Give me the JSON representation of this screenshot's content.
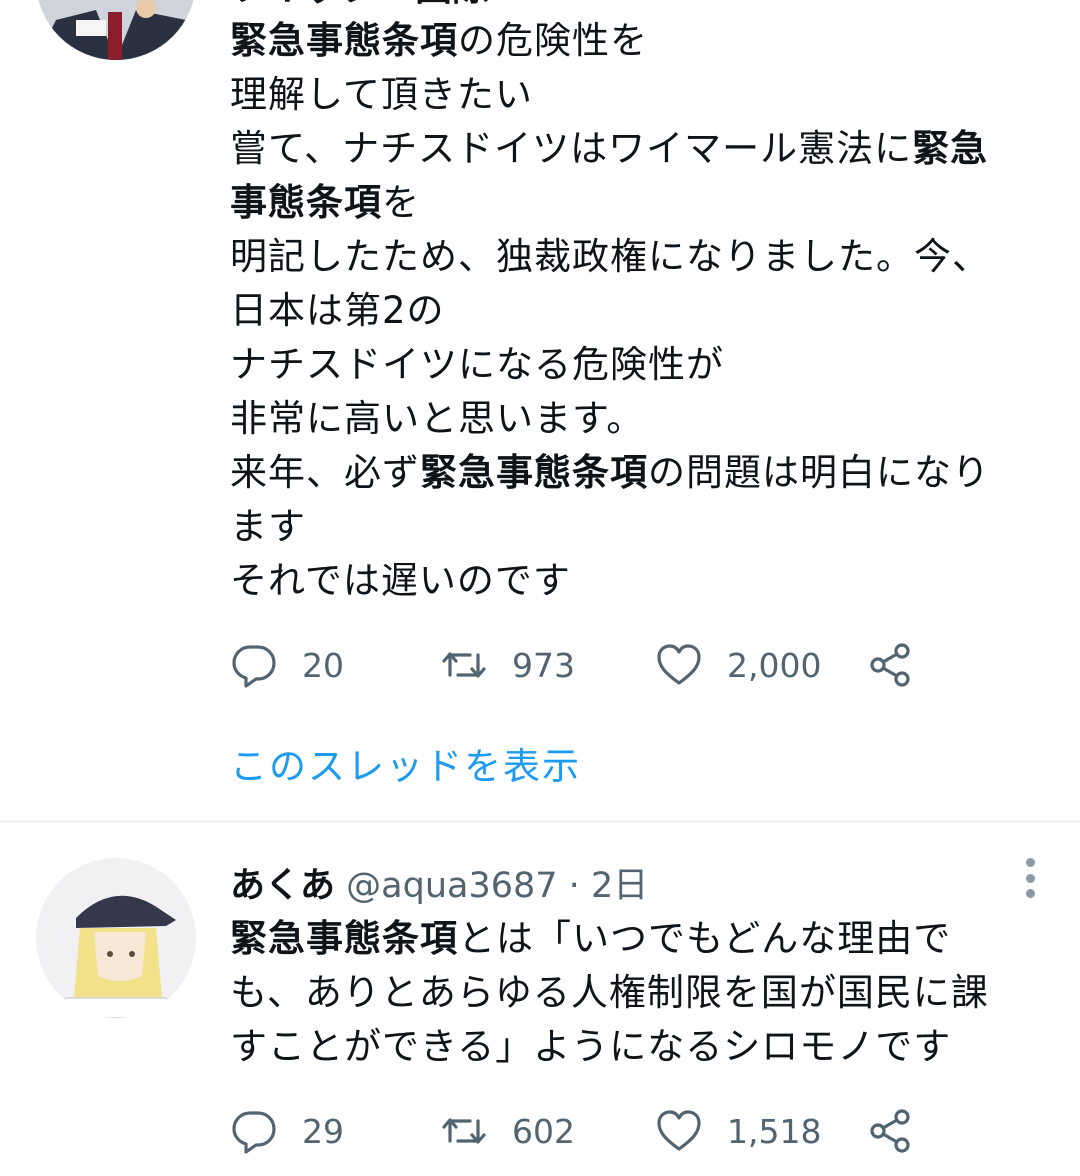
{
  "tweet1": {
    "cut_header": "ツイッター国際",
    "lines": [
      [
        {
          "t": "緊急事態条項",
          "b": true
        },
        {
          "t": "の危険性を",
          "b": false
        }
      ],
      [
        {
          "t": "理解して頂きたい",
          "b": false
        }
      ],
      [
        {
          "t": "嘗て、ナチスドイツはワイマール憲法に",
          "b": false
        },
        {
          "t": "緊急",
          "b": true
        }
      ],
      [
        {
          "t": "事態条項",
          "b": true
        },
        {
          "t": "を",
          "b": false
        }
      ],
      [
        {
          "t": "明記したため、独裁政権になりました。今、",
          "b": false
        }
      ],
      [
        {
          "t": "日本は第2の",
          "b": false
        }
      ],
      [
        {
          "t": "ナチスドイツになる危険性が",
          "b": false
        }
      ],
      [
        {
          "t": "非常に高いと思います。",
          "b": false
        }
      ],
      [
        {
          "t": "来年、必ず",
          "b": false
        },
        {
          "t": "緊急事態条項",
          "b": true
        },
        {
          "t": "の問題は明白になり",
          "b": false
        }
      ],
      [
        {
          "t": "ます",
          "b": false
        }
      ],
      [
        {
          "t": "それでは遅いのです",
          "b": false
        }
      ]
    ],
    "replies": "20",
    "retweets": "973",
    "likes": "2,000",
    "thread_link": "このスレッドを表示"
  },
  "tweet2": {
    "display_name": "あくあ",
    "handle": "@aqua3687",
    "separator": "·",
    "time": "2日",
    "lines": [
      [
        {
          "t": "緊急事態条項",
          "b": true
        },
        {
          "t": "とは「いつでもどんな理由で",
          "b": false
        }
      ],
      [
        {
          "t": "も、ありとあらゆる人権制限を国が国民に課",
          "b": false
        }
      ],
      [
        {
          "t": "すことができる」ようになるシロモノです",
          "b": false
        }
      ]
    ],
    "replies": "29",
    "retweets": "602",
    "likes": "1,518"
  },
  "colors": {
    "text": "#0f1419",
    "muted": "#536471",
    "link": "#1d9bf0",
    "divider": "#eff3f4"
  },
  "icons": {
    "reply": "reply-icon",
    "retweet": "retweet-icon",
    "like": "heart-icon",
    "share": "share-icon",
    "more": "more-icon"
  }
}
